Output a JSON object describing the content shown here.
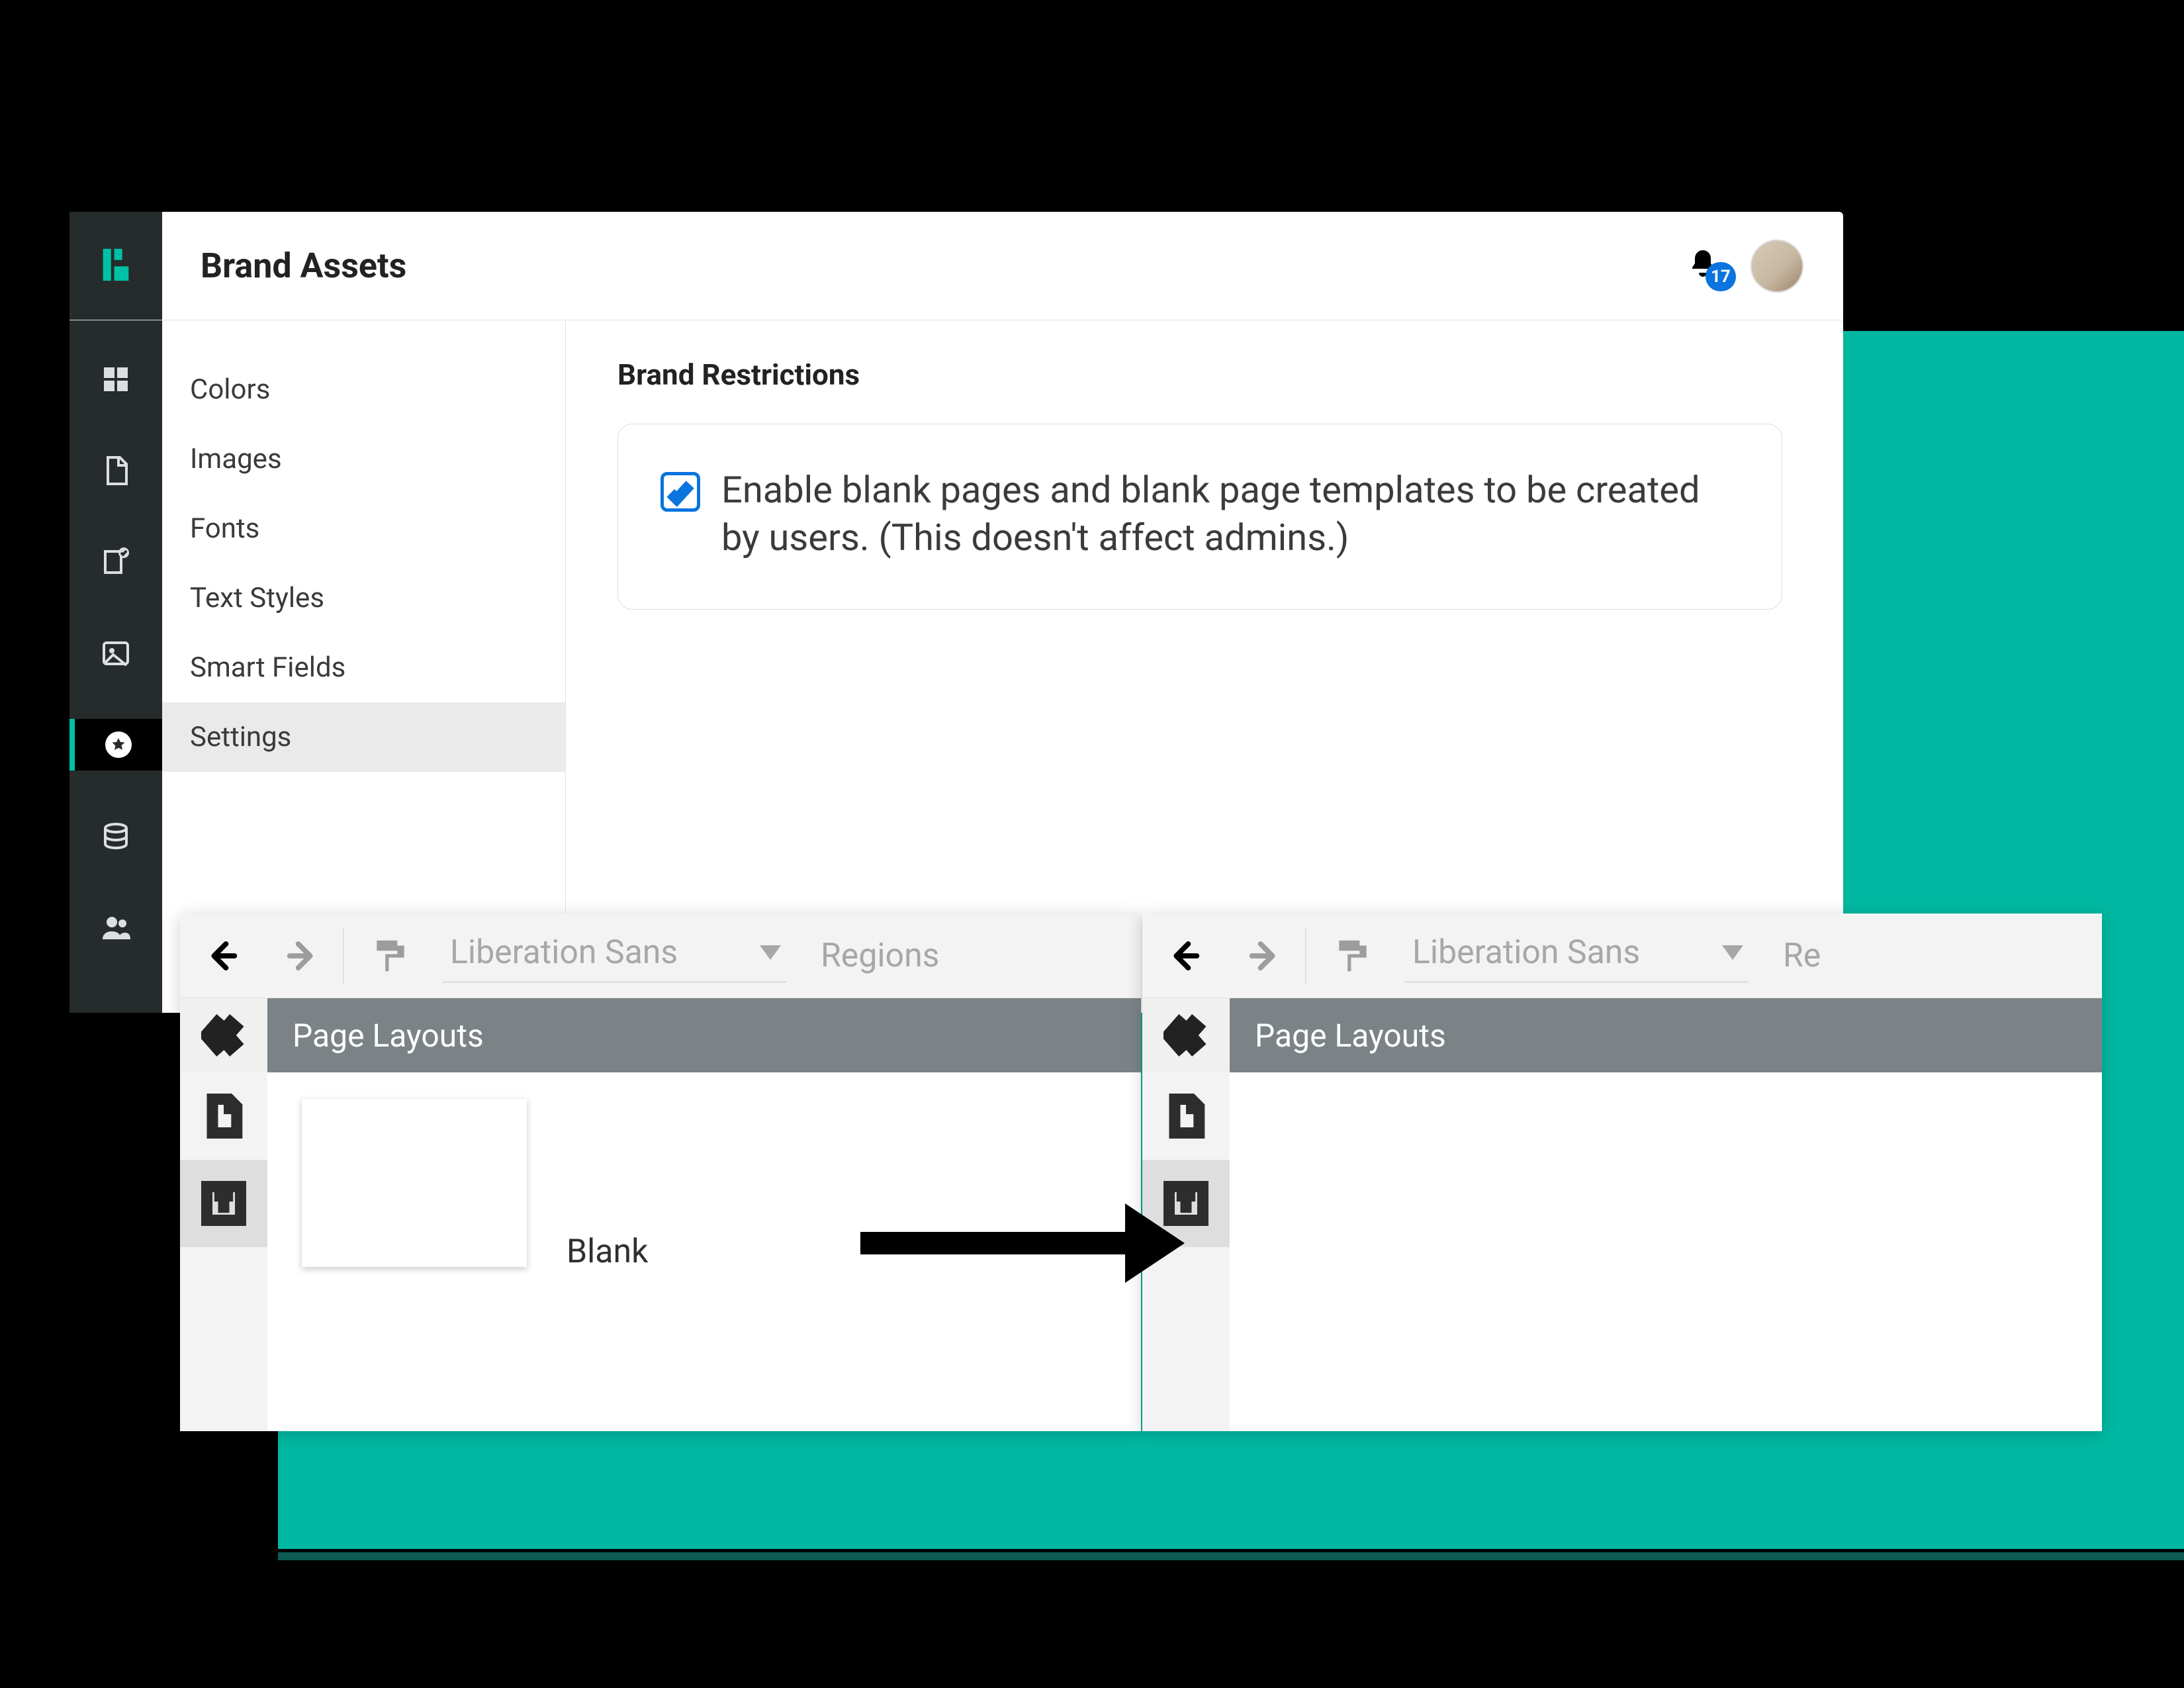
{
  "header": {
    "title": "Brand Assets",
    "notifications_count": "17"
  },
  "sidelist": {
    "items": [
      {
        "label": "Colors"
      },
      {
        "label": "Images"
      },
      {
        "label": "Fonts"
      },
      {
        "label": "Text Styles"
      },
      {
        "label": "Smart Fields"
      },
      {
        "label": "Settings"
      }
    ],
    "selected_index": 5
  },
  "main": {
    "section_title": "Brand Restrictions",
    "restriction_text": "Enable blank pages and blank page templates to be created by users. (This doesn't affect admins.)",
    "checkbox_checked": true
  },
  "editor_panel": {
    "font_name": "Liberation Sans",
    "mode_label_left": "Regions",
    "mode_label_right": "Re",
    "panel_title": "Page Layouts",
    "blank_label": "Blank"
  }
}
